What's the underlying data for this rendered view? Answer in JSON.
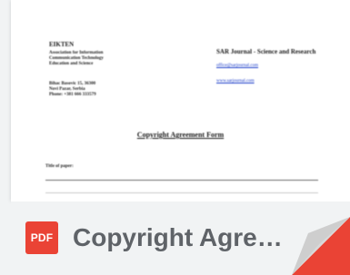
{
  "document": {
    "org_name": "EIKTEN",
    "org_lines": [
      "Association for Information",
      "Communication Technology",
      "Education and Science"
    ],
    "addr_lines": [
      "Bihac Basovic 15, 36300",
      "Novi Pazar, Serbia",
      "Phone: +381 666 333579"
    ],
    "journal_title": "SAR Journal - Science and Research",
    "journal_links": [
      "office@sarjournal.com",
      "www.sarjournal.com"
    ],
    "form_title": "Copyright Agreement Form",
    "field_label": "Title of paper:"
  },
  "footer": {
    "file_type_label": "PDF",
    "file_name": "Copyright Agree..."
  },
  "colors": {
    "pdf_red": "#ea4335",
    "filename_gray": "#5f6368",
    "card_background": "#f1f3f4"
  },
  "icons": {
    "file_type": "pdf-icon",
    "corner": "page-fold-icon"
  }
}
